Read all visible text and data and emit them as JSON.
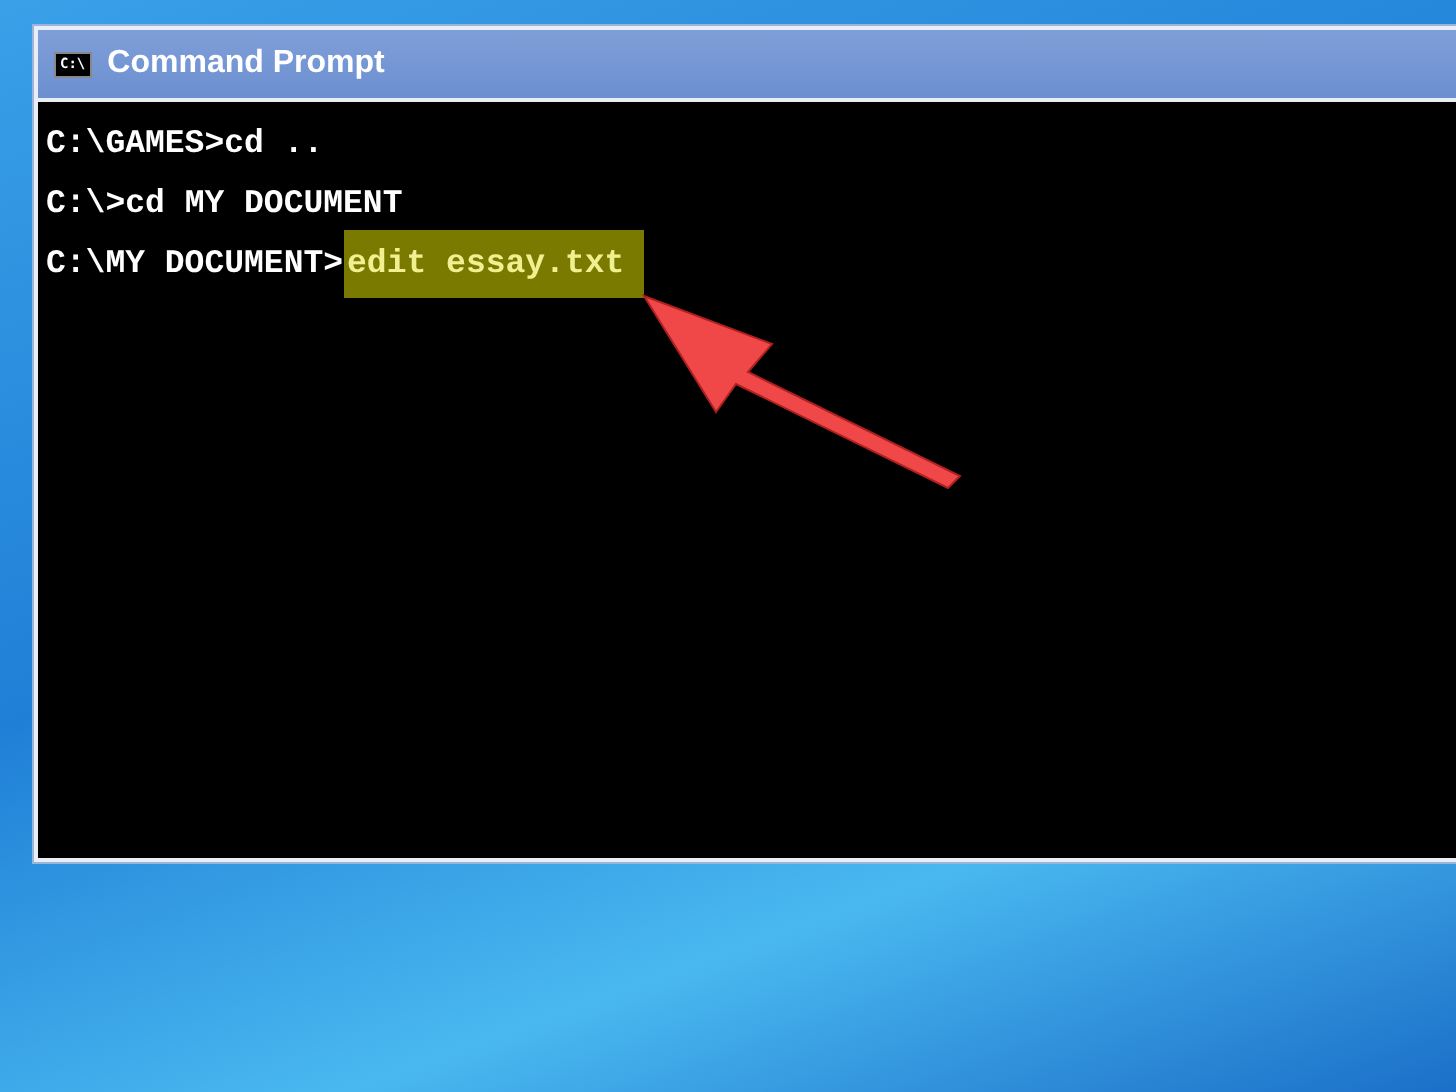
{
  "window": {
    "title": "Command Prompt",
    "icon_text": "C:\\"
  },
  "console": {
    "lines": [
      {
        "prompt": "C:\\GAMES>",
        "command": "cd ..",
        "highlighted": false
      },
      {
        "prompt": "C:\\>",
        "command": "cd MY DOCUMENT",
        "highlighted": false
      },
      {
        "prompt": "C:\\MY DOCUMENT>",
        "command": "edit essay.txt",
        "highlighted": true
      }
    ]
  }
}
